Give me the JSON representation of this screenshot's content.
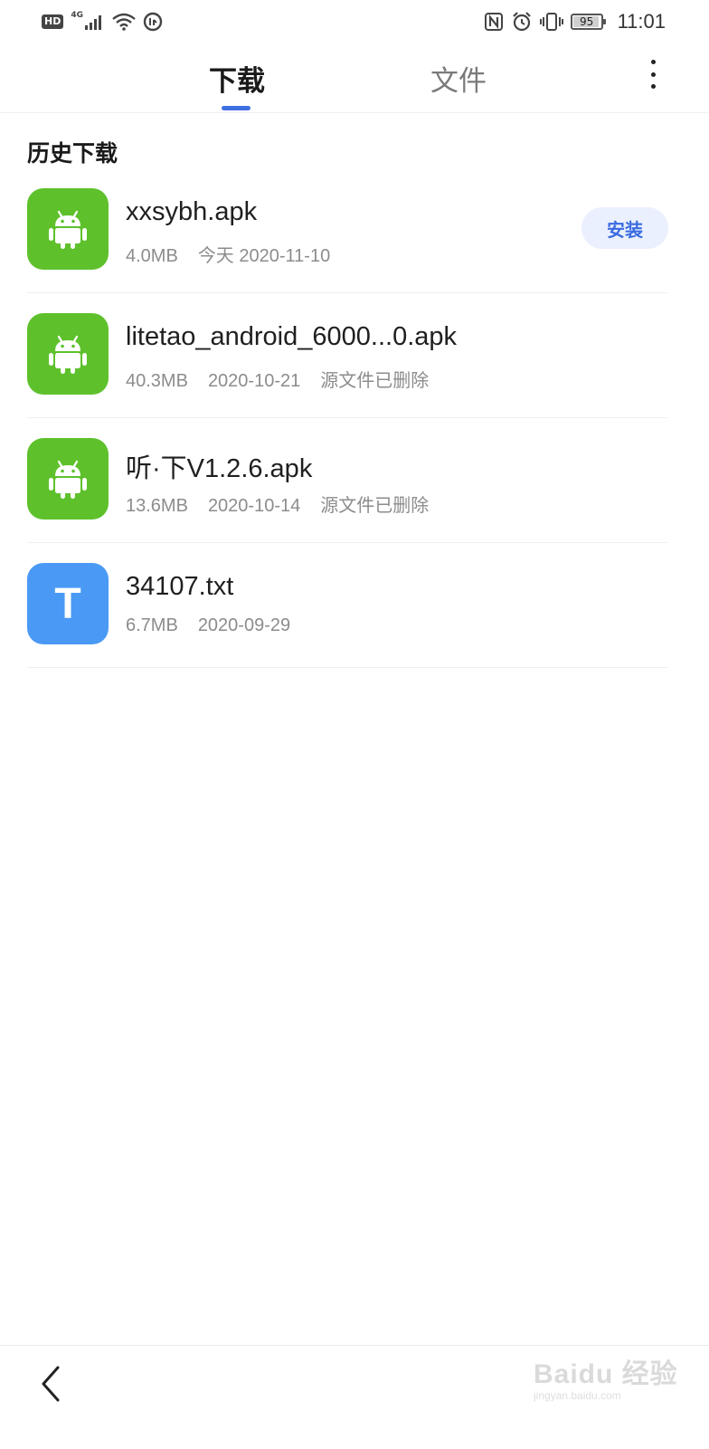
{
  "status_bar": {
    "hd_label": "HD",
    "network_label": "4G",
    "battery_level": "95",
    "time": "11:01",
    "left_icons": [
      "hd-icon",
      "signal-icon",
      "wifi-icon",
      "data-saver-icon"
    ],
    "right_icons": [
      "nfc-icon",
      "alarm-icon",
      "vibrate-icon",
      "battery-icon"
    ]
  },
  "tabs": {
    "download_label": "下载",
    "files_label": "文件",
    "active": "下载",
    "accent_color": "#3f6fe0"
  },
  "section": {
    "title": "历史下载"
  },
  "items": [
    {
      "icon": "android-icon",
      "icon_color": "#5ec12c",
      "name": "xxsybh.apk",
      "size": "4.0MB",
      "date": "今天 2020-11-10",
      "status": "",
      "action_label": "安装"
    },
    {
      "icon": "android-icon",
      "icon_color": "#5ec12c",
      "name": "litetao_android_6000...0.apk",
      "size": "40.3MB",
      "date": "2020-10-21",
      "status": "源文件已删除"
    },
    {
      "icon": "android-icon",
      "icon_color": "#5ec12c",
      "name": "听·下V1.2.6.apk",
      "size": "13.6MB",
      "date": "2020-10-14",
      "status": "源文件已删除"
    },
    {
      "icon": "text-file-icon",
      "icon_color": "#4a9af5",
      "icon_letter": "T",
      "name": "34107.txt",
      "size": "6.7MB",
      "date": "2020-09-29",
      "status": ""
    }
  ],
  "bottom_bar": {
    "back_icon": "chevron-left-icon"
  },
  "watermark": {
    "main": "Baidu 经验",
    "sub": "jingyan.baidu.com"
  }
}
